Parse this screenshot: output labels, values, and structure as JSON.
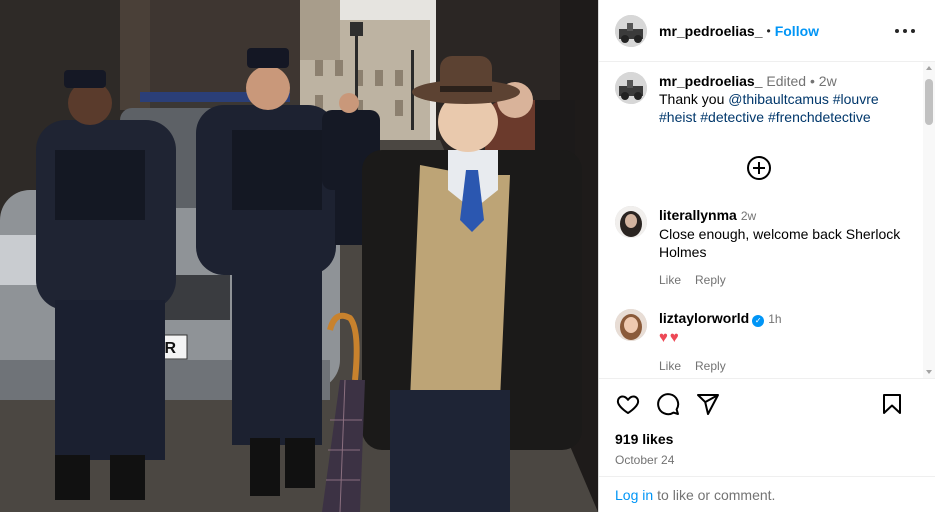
{
  "post": {
    "username": "mr_pedroelias_",
    "follow_label": "Follow",
    "separator": "•"
  },
  "caption": {
    "username": "mr_pedroelias_",
    "edited": "Edited •",
    "time": "2w",
    "text_before": "Thank you ",
    "mention": "@thibaultcamus",
    "tags": [
      "#louvre",
      "#heist",
      "#detective",
      "#frenchdetective"
    ]
  },
  "comments": [
    {
      "username": "literallynma",
      "time": "2w",
      "text": "Close enough, welcome back Sherlock Holmes",
      "verified": false,
      "like_label": "Like",
      "reply_label": "Reply"
    },
    {
      "username": "liztaylorworld",
      "time": "1h",
      "text": "♥♥",
      "verified": true,
      "like_label": "Like",
      "reply_label": "Reply"
    }
  ],
  "icons": {
    "like": "heart-icon",
    "comment": "speech-bubble-icon",
    "share": "paper-plane-icon",
    "save": "bookmark-icon",
    "more": "more-options-icon",
    "load_more": "plus-circle-icon",
    "verified": "verified-badge-icon"
  },
  "engagement": {
    "likes": "919 likes",
    "date": "October 24"
  },
  "login": {
    "link": "Log in",
    "text": "to like or comment."
  },
  "colors": {
    "accent": "#0095f6",
    "link": "#00376b",
    "heart": "#ed4956",
    "muted": "#737373"
  }
}
